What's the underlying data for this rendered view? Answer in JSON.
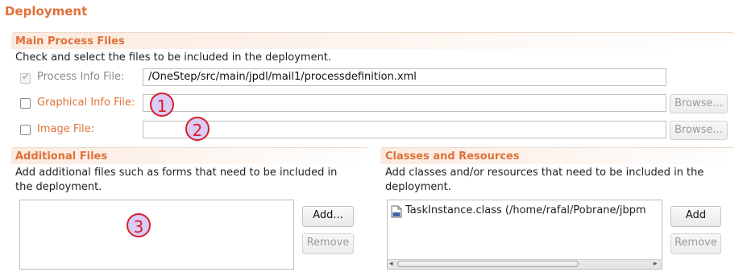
{
  "page": {
    "title": "Deployment"
  },
  "main_process_files": {
    "title": "Main Process Files",
    "description": "Check and select the files to be included in the deployment.",
    "rows": [
      {
        "label": "Process Info File:",
        "checked": true,
        "enabled": false,
        "value": "/OneStep/src/main/jpdl/mail1/processdefinition.xml"
      },
      {
        "label": "Graphical Info File:",
        "checked": false,
        "enabled": true,
        "value": "",
        "browse": "Browse..."
      },
      {
        "label": "Image File:",
        "checked": false,
        "enabled": true,
        "value": "",
        "browse": "Browse..."
      }
    ]
  },
  "additional_files": {
    "title": "Additional Files",
    "description_line1": "Add additional files such as forms that need to be included in",
    "description_line2": "the deployment.",
    "add_label": "Add...",
    "remove_label": "Remove"
  },
  "classes_resources": {
    "title": "Classes and Resources",
    "description_line1": "Add classes and/or resources that need to be included in the",
    "description_line2": "deployment.",
    "items": [
      {
        "icon": "class-file-icon",
        "label": "TaskInstance.class (/home/rafal/Pobrane/jbpm"
      }
    ],
    "add_label": "Add",
    "remove_label": "Remove"
  },
  "annotations": [
    "1",
    "2",
    "3"
  ],
  "colors": {
    "accent": "#e0703a",
    "badge_border": "#d91f2b",
    "badge_fill": "#d9ccf5"
  }
}
